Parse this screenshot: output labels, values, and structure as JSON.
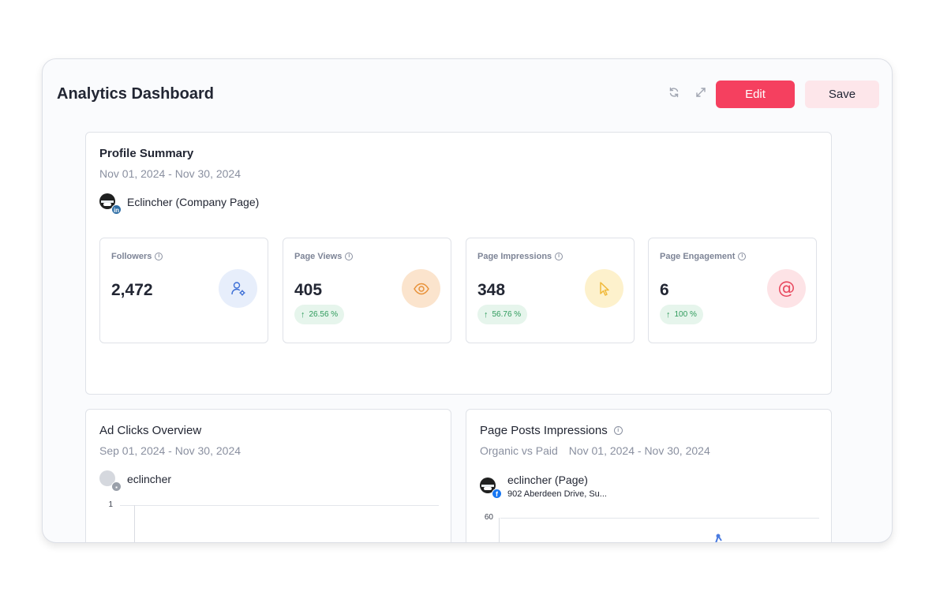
{
  "header": {
    "title": "Analytics Dashboard",
    "edit_label": "Edit",
    "save_label": "Save",
    "icons": [
      "refresh-icon",
      "expand-icon"
    ]
  },
  "profile_summary": {
    "title": "Profile Summary",
    "date_range": "Nov 01, 2024 - Nov 30, 2024",
    "account_name": "Eclincher (Company Page)",
    "account_network": "linkedin",
    "metrics": [
      {
        "label": "Followers",
        "value": "2,472",
        "icon": "user-gear-icon",
        "color": "#3d6fd6"
      },
      {
        "label": "Page Views",
        "value": "405",
        "change": "26.56 %",
        "icon": "eye-icon",
        "color": "#e8923a"
      },
      {
        "label": "Page Impressions",
        "value": "348",
        "change": "56.76 %",
        "icon": "cursor-icon",
        "color": "#f0b93a"
      },
      {
        "label": "Page Engagement",
        "value": "6",
        "change": "100 %",
        "icon": "at-icon",
        "color": "#e8485e"
      }
    ]
  },
  "ad_clicks": {
    "title": "Ad Clicks Overview",
    "date_range": "Sep 01, 2024 - Nov 30, 2024",
    "account_name": "eclincher",
    "y_tick": "1"
  },
  "page_posts": {
    "title": "Page Posts Impressions",
    "subtitle": "Organic vs Paid",
    "date_range": "Nov 01, 2024 - Nov 30, 2024",
    "account_name": "eclincher (Page)",
    "account_address": "902 Aberdeen Drive, Su...",
    "account_network": "facebook",
    "y_tick": "60"
  },
  "colors": {
    "accent": "#f5405f",
    "save_bg": "#fde6ea",
    "trend_green": "#2f9b5c"
  }
}
